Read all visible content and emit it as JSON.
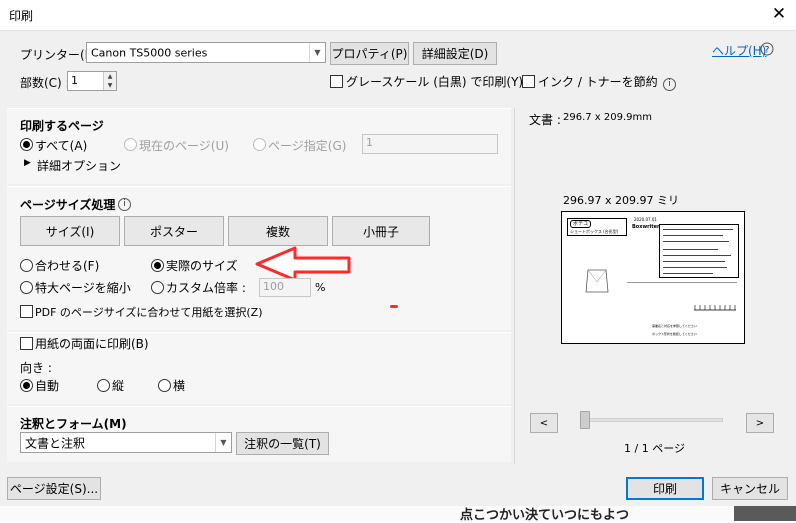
{
  "window": {
    "title": "印刷",
    "close": "✕"
  },
  "printer": {
    "label": "プリンター(N) :",
    "selected": "Canon TS5000 series",
    "properties_button": "プロパティ(P)",
    "advanced_button": "詳細設定(D)",
    "help_link": "ヘルプ(H)",
    "copies_label": "部数(C) :",
    "copies_value": "1",
    "grayscale_label": "グレースケール (白黒) で印刷(Y)",
    "save_ink_label": "インク / トナーを節約"
  },
  "pages_section": {
    "title": "印刷するページ",
    "all": "すべて(A)",
    "current": "現在のページ(U)",
    "range": "ページ指定(G)",
    "range_value": "1",
    "more_options": "詳細オプション"
  },
  "sizing_section": {
    "title": "ページサイズ処理",
    "buttons": [
      "サイズ(I)",
      "ポスター",
      "複数",
      "小冊子"
    ],
    "fit": "合わせる(F)",
    "actual_size": "実際のサイズ",
    "shrink": "特大ページを縮小",
    "custom_scale": "カスタム倍率 :",
    "scale_value": "100",
    "percent": "%",
    "pdf_paper": "PDF のページサイズに合わせて用紙を選択(Z)"
  },
  "duplex_section": {
    "duplex": "用紙の両面に印刷(B)",
    "orientation_label": "向き :",
    "auto": "自動",
    "portrait": "縦",
    "landscape": "横"
  },
  "comments_section": {
    "title": "注釈とフォーム(M)",
    "selected": "文書と注釈",
    "summary_button": "注釈の一覧(T)"
  },
  "preview": {
    "doc_label": "文書 :",
    "doc_size": "296.7 x 209.9mm",
    "page_size": "296.97 x 209.97 ミリ",
    "prev": "<",
    "next": ">",
    "page_indicator": "1 / 1 ページ",
    "thumb_tag": "ボデゴ",
    "thumb_heading": "ショートボックス (台形型)",
    "thumb_date": "2020.07.01",
    "thumb_title": "Boxwriter",
    "thumb_note_1": "事業名と対応を参照してください",
    "thumb_note_2": "ボックス形状を確認してください"
  },
  "footer": {
    "page_setup": "ページ設定(S)...",
    "print": "印刷",
    "cancel": "キャンセル"
  },
  "behind_text": "点こつかい決ていつにもよつ",
  "colors": {
    "accent": "#0078d7",
    "annotation_arrow": "#ff2a2a",
    "link": "#0066cc"
  }
}
